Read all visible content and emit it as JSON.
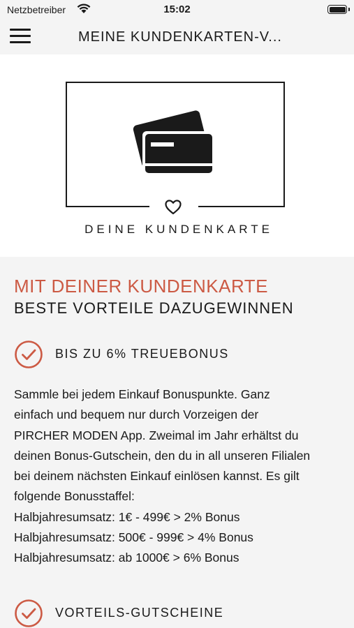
{
  "status_bar": {
    "carrier": "Netzbetreiber",
    "time": "15:02"
  },
  "nav": {
    "title": "MEINE KUNDENKARTEN-V..."
  },
  "hero": {
    "caption": "DEINE KUNDENKARTE"
  },
  "content": {
    "heading_accent": "MIT DEINER KUNDENKARTE",
    "heading_sub": "BESTE VORTEILE DAZUGEWINNEN",
    "benefits": [
      {
        "label": "BIS ZU 6% TREUEBONUS"
      },
      {
        "label": "VORTEILS-GUTSCHEINE"
      }
    ],
    "body_lines": [
      "Sammle bei jedem Einkauf Bonuspunkte. Ganz",
      "einfach und bequem nur durch Vorzeigen der",
      "PIRCHER MODEN App. Zweimal im Jahr erhältst du",
      "deinen Bonus-Gutschein, den du in all unseren Filialen",
      "bei deinem nächsten Einkauf einlösen kannst. Es gilt",
      "folgende Bonusstaffel:",
      "Halbjahresumsatz: 1€ - 499€ > 2% Bonus",
      "Halbjahresumsatz: 500€ - 999€ > 4% Bonus",
      "Halbjahresumsatz: ab 1000€ > 6% Bonus"
    ]
  },
  "colors": {
    "accent": "#cc5a44",
    "text": "#1a1a1a",
    "background": "#f4f4f4",
    "hero_background": "#ffffff"
  },
  "icons": [
    "menu-icon",
    "wifi-icon",
    "battery-icon",
    "credit-cards-icon",
    "heart-icon",
    "check-circle-icon"
  ]
}
